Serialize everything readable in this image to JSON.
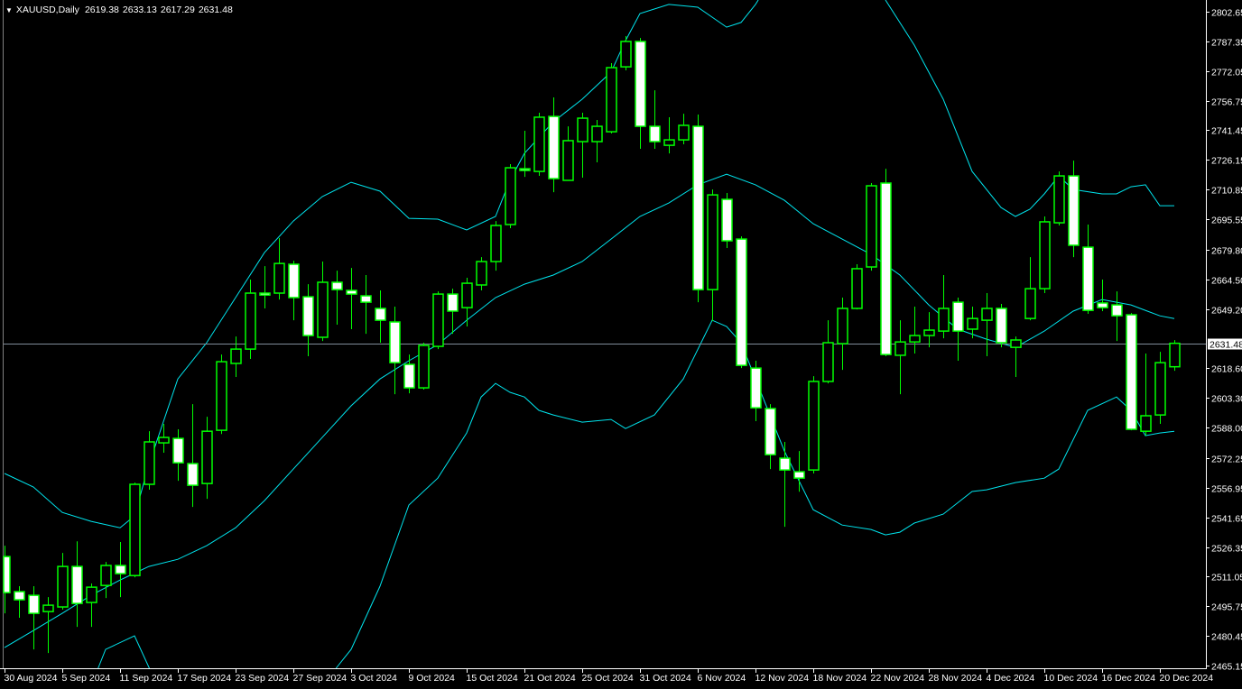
{
  "header": {
    "symbol_timeframe": "XAUUSD,Daily",
    "open": "2619.38",
    "high": "2633.13",
    "low": "2617.29",
    "close": "2631.48"
  },
  "colors": {
    "background": "#000000",
    "candle_outline": "#00ff00",
    "bull_body": "#000000",
    "bear_body": "#ffffff",
    "bands": "#00e5ee",
    "price_line": "#7f8c99",
    "axis": "#ffffff"
  },
  "chart_data": {
    "type": "candlestick",
    "title": "XAUUSD,Daily",
    "ylim": [
      2465.15,
      2802.65
    ],
    "current_price": 2631.48,
    "current_price_label": "2631.48",
    "price_ticks": [
      "2802.65",
      "2787.35",
      "2772.05",
      "2756.75",
      "2741.45",
      "2726.15",
      "2710.85",
      "2695.55",
      "2679.80",
      "2664.50",
      "2649.20",
      "2618.60",
      "2603.30",
      "2588.00",
      "2572.25",
      "2556.95",
      "2541.65",
      "2526.35",
      "2511.05",
      "2495.75",
      "2480.45",
      "2465.15"
    ],
    "date_labels": [
      {
        "index": 0,
        "label": "30 Aug 2024"
      },
      {
        "index": 4,
        "label": "5 Sep 2024"
      },
      {
        "index": 8,
        "label": "11 Sep 2024"
      },
      {
        "index": 12,
        "label": "17 Sep 2024"
      },
      {
        "index": 16,
        "label": "23 Sep 2024"
      },
      {
        "index": 20,
        "label": "27 Sep 2024"
      },
      {
        "index": 24,
        "label": "3 Oct 2024"
      },
      {
        "index": 28,
        "label": "9 Oct 2024"
      },
      {
        "index": 32,
        "label": "15 Oct 2024"
      },
      {
        "index": 36,
        "label": "21 Oct 2024"
      },
      {
        "index": 40,
        "label": "25 Oct 2024"
      },
      {
        "index": 44,
        "label": "31 Oct 2024"
      },
      {
        "index": 48,
        "label": "6 Nov 2024"
      },
      {
        "index": 52,
        "label": "12 Nov 2024"
      },
      {
        "index": 56,
        "label": "18 Nov 2024"
      },
      {
        "index": 60,
        "label": "22 Nov 2024"
      },
      {
        "index": 64,
        "label": "28 Nov 2024"
      },
      {
        "index": 68,
        "label": "4 Dec 2024"
      },
      {
        "index": 72,
        "label": "10 Dec 2024"
      },
      {
        "index": 76,
        "label": "16 Dec 2024"
      },
      {
        "index": 80,
        "label": "20 Dec 2024"
      }
    ],
    "ohlc": [
      [
        2521.4,
        2527.0,
        2492.1,
        2502.8
      ],
      [
        2503.3,
        2506.1,
        2489.8,
        2499.1
      ],
      [
        2501.4,
        2506.1,
        2473.5,
        2492.1
      ],
      [
        2493.0,
        2500.5,
        2471.6,
        2496.3
      ],
      [
        2495.4,
        2523.3,
        2494.0,
        2516.3
      ],
      [
        2516.3,
        2529.3,
        2485.1,
        2497.2
      ],
      [
        2497.7,
        2507.5,
        2485.1,
        2505.6
      ],
      [
        2506.5,
        2518.6,
        2500.0,
        2516.8
      ],
      [
        2516.8,
        2528.9,
        2500.5,
        2512.6
      ],
      [
        2511.6,
        2559.6,
        2510.7,
        2558.7
      ],
      [
        2558.7,
        2586.1,
        2555.9,
        2580.6
      ],
      [
        2580.1,
        2589.9,
        2575.0,
        2582.9
      ],
      [
        2582.4,
        2587.1,
        2560.5,
        2569.8
      ],
      [
        2569.4,
        2600.1,
        2547.0,
        2558.2
      ],
      [
        2559.1,
        2593.6,
        2551.2,
        2586.1
      ],
      [
        2586.6,
        2625.7,
        2584.7,
        2622.0
      ],
      [
        2621.1,
        2635.0,
        2614.1,
        2628.5
      ],
      [
        2628.5,
        2664.4,
        2623.4,
        2657.4
      ],
      [
        2657.4,
        2671.3,
        2649.5,
        2656.4
      ],
      [
        2657.4,
        2685.8,
        2654.1,
        2672.7
      ],
      [
        2672.3,
        2674.1,
        2643.4,
        2655.1
      ],
      [
        2655.5,
        2662.0,
        2624.8,
        2635.5
      ],
      [
        2634.6,
        2673.7,
        2632.7,
        2663.0
      ],
      [
        2663.0,
        2669.0,
        2641.1,
        2659.2
      ],
      [
        2658.8,
        2670.4,
        2638.8,
        2656.9
      ],
      [
        2656.0,
        2666.7,
        2636.4,
        2652.7
      ],
      [
        2649.5,
        2658.8,
        2631.8,
        2643.4
      ],
      [
        2642.5,
        2650.4,
        2605.2,
        2621.5
      ],
      [
        2620.6,
        2625.7,
        2605.7,
        2608.5
      ],
      [
        2608.5,
        2631.8,
        2607.6,
        2630.4
      ],
      [
        2629.9,
        2658.3,
        2628.5,
        2656.9
      ],
      [
        2656.9,
        2659.7,
        2636.4,
        2648.1
      ],
      [
        2649.9,
        2665.3,
        2640.2,
        2662.5
      ],
      [
        2661.6,
        2676.0,
        2658.8,
        2673.7
      ],
      [
        2673.7,
        2694.6,
        2669.0,
        2692.3
      ],
      [
        2692.8,
        2724.0,
        2690.9,
        2722.1
      ],
      [
        2721.6,
        2741.2,
        2717.4,
        2720.7
      ],
      [
        2720.2,
        2750.5,
        2717.9,
        2748.2
      ],
      [
        2748.6,
        2758.4,
        2709.5,
        2716.5
      ],
      [
        2715.6,
        2743.5,
        2715.6,
        2736.1
      ],
      [
        2735.6,
        2750.5,
        2717.0,
        2747.7
      ],
      [
        2735.6,
        2746.8,
        2724.9,
        2743.5
      ],
      [
        2740.7,
        2776.1,
        2739.8,
        2773.8
      ],
      [
        2774.2,
        2790.1,
        2772.4,
        2787.3
      ],
      [
        2787.3,
        2789.1,
        2731.9,
        2743.5
      ],
      [
        2743.5,
        2762.1,
        2731.9,
        2735.6
      ],
      [
        2733.7,
        2748.2,
        2729.5,
        2736.5
      ],
      [
        2736.5,
        2750.0,
        2734.2,
        2744.0
      ],
      [
        2743.5,
        2749.6,
        2652.7,
        2659.2
      ],
      [
        2659.2,
        2710.9,
        2642.9,
        2708.1
      ],
      [
        2705.8,
        2709.1,
        2680.7,
        2684.4
      ],
      [
        2685.3,
        2686.7,
        2618.7,
        2620.1
      ],
      [
        2618.7,
        2622.5,
        2591.3,
        2598.2
      ],
      [
        2597.8,
        2600.1,
        2566.6,
        2574.0
      ],
      [
        2572.2,
        2580.6,
        2536.8,
        2566.1
      ],
      [
        2565.2,
        2575.9,
        2554.9,
        2561.9
      ],
      [
        2566.1,
        2614.5,
        2564.3,
        2611.8
      ],
      [
        2611.8,
        2643.4,
        2610.8,
        2631.8
      ],
      [
        2631.3,
        2655.1,
        2617.8,
        2649.5
      ],
      [
        2649.5,
        2672.3,
        2649.0,
        2670.0
      ],
      [
        2670.9,
        2714.2,
        2669.0,
        2712.8
      ],
      [
        2714.2,
        2721.6,
        2624.8,
        2625.7
      ],
      [
        2625.3,
        2643.4,
        2605.2,
        2632.2
      ],
      [
        2632.2,
        2650.4,
        2626.2,
        2635.5
      ],
      [
        2635.5,
        2647.6,
        2629.4,
        2638.3
      ],
      [
        2637.8,
        2666.7,
        2634.1,
        2649.5
      ],
      [
        2652.7,
        2655.1,
        2622.5,
        2637.8
      ],
      [
        2638.8,
        2650.4,
        2634.1,
        2644.3
      ],
      [
        2643.4,
        2657.4,
        2624.8,
        2649.5
      ],
      [
        2649.5,
        2651.8,
        2629.4,
        2631.8
      ],
      [
        2629.4,
        2635.0,
        2614.1,
        2633.2
      ],
      [
        2644.3,
        2676.0,
        2643.4,
        2659.7
      ],
      [
        2659.7,
        2697.0,
        2657.4,
        2694.2
      ],
      [
        2693.7,
        2720.2,
        2692.3,
        2717.9
      ],
      [
        2717.9,
        2725.8,
        2676.0,
        2682.1
      ],
      [
        2681.1,
        2692.8,
        2646.7,
        2648.5
      ],
      [
        2652.3,
        2664.4,
        2648.1,
        2649.9
      ],
      [
        2651.3,
        2658.3,
        2632.7,
        2645.7
      ],
      [
        2646.2,
        2647.1,
        2586.6,
        2587.1
      ],
      [
        2586.1,
        2626.2,
        2583.8,
        2594.1
      ],
      [
        2594.5,
        2627.1,
        2589.9,
        2621.5
      ],
      [
        2619.38,
        2633.13,
        2617.29,
        2631.48
      ]
    ],
    "bollinger": {
      "middle": [
        [
          0,
          2474.4
        ],
        [
          2,
          2483.2
        ],
        [
          4,
          2492.1
        ],
        [
          6,
          2501.4
        ],
        [
          8,
          2509.3
        ],
        [
          10,
          2516.3
        ],
        [
          12,
          2520.0
        ],
        [
          14,
          2527.0
        ],
        [
          16,
          2536.3
        ],
        [
          18,
          2550.3
        ],
        [
          20,
          2566.6
        ],
        [
          22,
          2582.9
        ],
        [
          24,
          2599.2
        ],
        [
          26,
          2613.1
        ],
        [
          28,
          2622.5
        ],
        [
          30,
          2630.8
        ],
        [
          32,
          2643.4
        ],
        [
          34,
          2655.1
        ],
        [
          36,
          2662.0
        ],
        [
          38,
          2666.7
        ],
        [
          40,
          2673.7
        ],
        [
          42,
          2685.3
        ],
        [
          44,
          2697.0
        ],
        [
          46,
          2703.9
        ],
        [
          48,
          2713.3
        ],
        [
          50,
          2718.8
        ],
        [
          52,
          2713.3
        ],
        [
          54,
          2705.3
        ],
        [
          56,
          2693.2
        ],
        [
          58,
          2685.3
        ],
        [
          60,
          2677.4
        ],
        [
          62,
          2666.7
        ],
        [
          64,
          2651.3
        ],
        [
          66,
          2638.8
        ],
        [
          68,
          2633.6
        ],
        [
          70,
          2629.4
        ],
        [
          72,
          2637.8
        ],
        [
          74,
          2648.1
        ],
        [
          76,
          2654.1
        ],
        [
          78,
          2651.3
        ],
        [
          80,
          2645.7
        ],
        [
          81,
          2644.3
        ]
      ],
      "upper": [
        [
          0,
          2564.3
        ],
        [
          2,
          2557.3
        ],
        [
          4,
          2544.2
        ],
        [
          6,
          2539.6
        ],
        [
          8,
          2536.3
        ],
        [
          9,
          2542.4
        ],
        [
          10,
          2568.9
        ],
        [
          12,
          2613.1
        ],
        [
          14,
          2631.8
        ],
        [
          16,
          2655.1
        ],
        [
          18,
          2678.3
        ],
        [
          20,
          2694.6
        ],
        [
          22,
          2707.2
        ],
        [
          24,
          2714.6
        ],
        [
          26,
          2710.0
        ],
        [
          28,
          2696.0
        ],
        [
          30,
          2695.6
        ],
        [
          32,
          2690.0
        ],
        [
          34,
          2697.0
        ],
        [
          35,
          2715.6
        ],
        [
          36,
          2729.5
        ],
        [
          38,
          2745.8
        ],
        [
          40,
          2757.5
        ],
        [
          42,
          2771.5
        ],
        [
          43,
          2787.7
        ],
        [
          44,
          2801.7
        ],
        [
          46,
          2806.4
        ],
        [
          48,
          2805.0
        ],
        [
          50,
          2794.7
        ],
        [
          51,
          2797.1
        ],
        [
          52,
          2806.4
        ],
        [
          54,
          2830.0
        ],
        [
          56,
          2850.0
        ],
        [
          58,
          2845.0
        ],
        [
          60,
          2825.0
        ],
        [
          61,
          2808.7
        ],
        [
          63,
          2785.4
        ],
        [
          65,
          2757.5
        ],
        [
          67,
          2720.2
        ],
        [
          69,
          2701.6
        ],
        [
          70,
          2697.0
        ],
        [
          71,
          2700.7
        ],
        [
          72,
          2708.6
        ],
        [
          73,
          2717.9
        ],
        [
          74,
          2710.9
        ],
        [
          76,
          2708.6
        ],
        [
          77,
          2708.6
        ],
        [
          78,
          2712.3
        ],
        [
          79,
          2713.3
        ],
        [
          80,
          2702.5
        ],
        [
          81,
          2702.5
        ]
      ],
      "lower": [
        [
          0,
          2440.0
        ],
        [
          6,
          2454.8
        ],
        [
          7,
          2473.5
        ],
        [
          9,
          2480.5
        ],
        [
          10,
          2464.2
        ],
        [
          12,
          2440.0
        ],
        [
          20,
          2430.0
        ],
        [
          22,
          2454.8
        ],
        [
          24,
          2473.5
        ],
        [
          26,
          2506.1
        ],
        [
          28,
          2548.0
        ],
        [
          30,
          2561.9
        ],
        [
          32,
          2585.2
        ],
        [
          33,
          2603.8
        ],
        [
          34,
          2610.8
        ],
        [
          35,
          2606.2
        ],
        [
          36,
          2603.8
        ],
        [
          37,
          2596.9
        ],
        [
          38,
          2594.5
        ],
        [
          40,
          2590.8
        ],
        [
          42,
          2592.2
        ],
        [
          43,
          2587.5
        ],
        [
          45,
          2594.5
        ],
        [
          47,
          2613.1
        ],
        [
          49,
          2643.4
        ],
        [
          50,
          2640.2
        ],
        [
          51,
          2631.8
        ],
        [
          52,
          2613.1
        ],
        [
          54,
          2575.9
        ],
        [
          56,
          2545.6
        ],
        [
          58,
          2537.7
        ],
        [
          60,
          2535.4
        ],
        [
          61,
          2532.6
        ],
        [
          62,
          2534.0
        ],
        [
          63,
          2538.7
        ],
        [
          65,
          2543.3
        ],
        [
          67,
          2555.0
        ],
        [
          68,
          2555.9
        ],
        [
          70,
          2559.6
        ],
        [
          72,
          2561.9
        ],
        [
          73,
          2566.6
        ],
        [
          75,
          2596.9
        ],
        [
          77,
          2603.8
        ],
        [
          78,
          2596.9
        ],
        [
          79,
          2583.8
        ],
        [
          80,
          2585.2
        ],
        [
          81,
          2586.1
        ]
      ]
    }
  }
}
